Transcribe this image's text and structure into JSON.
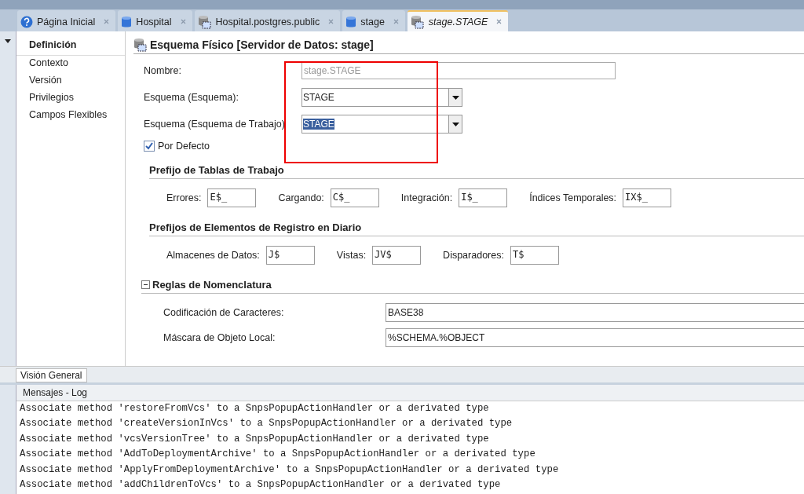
{
  "tabs": [
    {
      "label": "Página Inicial",
      "kind": "help",
      "selected": false
    },
    {
      "label": "Hospital",
      "kind": "database",
      "selected": false
    },
    {
      "label": "Hospital.postgres.public",
      "kind": "schema",
      "selected": false
    },
    {
      "label": "stage",
      "kind": "database",
      "selected": false
    },
    {
      "label": "stage.STAGE",
      "kind": "schema",
      "selected": true
    }
  ],
  "nav": [
    {
      "label": "Definición",
      "selected": true
    },
    {
      "label": "Contexto",
      "selected": false
    },
    {
      "label": "Versión",
      "selected": false
    },
    {
      "label": "Privilegios",
      "selected": false
    },
    {
      "label": "Campos Flexibles",
      "selected": false
    }
  ],
  "title": "Esquema Físico [Servidor de Datos: stage]",
  "nombre": {
    "label": "Nombre:",
    "value": "stage.STAGE",
    "disabled": true
  },
  "combos": [
    {
      "label": "Esquema (Esquema):",
      "value": "STAGE",
      "selected": false
    },
    {
      "label": "Esquema (Esquema de Trabajo)",
      "value": "STAGE",
      "selected": true
    }
  ],
  "default_check": {
    "label": "Por Defecto",
    "checked": true
  },
  "sections": [
    {
      "title": "Prefijo de Tablas de Trabajo",
      "fields": [
        {
          "label": "Errores:",
          "value": "E$_"
        },
        {
          "label": "Cargando:",
          "value": "C$_"
        },
        {
          "label": "Integración:",
          "value": "I$_"
        },
        {
          "label": "Índices Temporales:",
          "value": "IX$_"
        }
      ]
    },
    {
      "title": "Prefijos de Elementos de Registro en Diario",
      "fields": [
        {
          "label": "Almacenes de Datos:",
          "value": "J$"
        },
        {
          "label": "Vistas:",
          "value": "JV$"
        },
        {
          "label": "Disparadores:",
          "value": "T$"
        }
      ]
    }
  ],
  "naming": {
    "title": "Reglas de Nomenclatura",
    "expanded": true,
    "rows": [
      {
        "label": "Codificación de Caracteres:",
        "value": "BASE38"
      },
      {
        "label": "Máscara de Objeto Local:",
        "value": "%SCHEMA.%OBJECT"
      }
    ]
  },
  "overview_tab": "Visión General",
  "log": {
    "title": "Mensajes - Log",
    "lines": [
      "Associate method 'restoreFromVcs' to a SnpsPopupActionHandler or a derivated type",
      "Associate method 'createVersionInVcs' to a SnpsPopupActionHandler or a derivated type",
      "Associate method 'vcsVersionTree' to a SnpsPopupActionHandler or a derivated type",
      "Associate method 'AddToDeploymentArchive' to a SnpsPopupActionHandler or a derivated type",
      "Associate method 'ApplyFromDeploymentArchive' to a SnpsPopupActionHandler or a derivated type",
      "Associate method 'addChildrenToVcs' to a SnpsPopupActionHandler or a derivated type"
    ]
  }
}
